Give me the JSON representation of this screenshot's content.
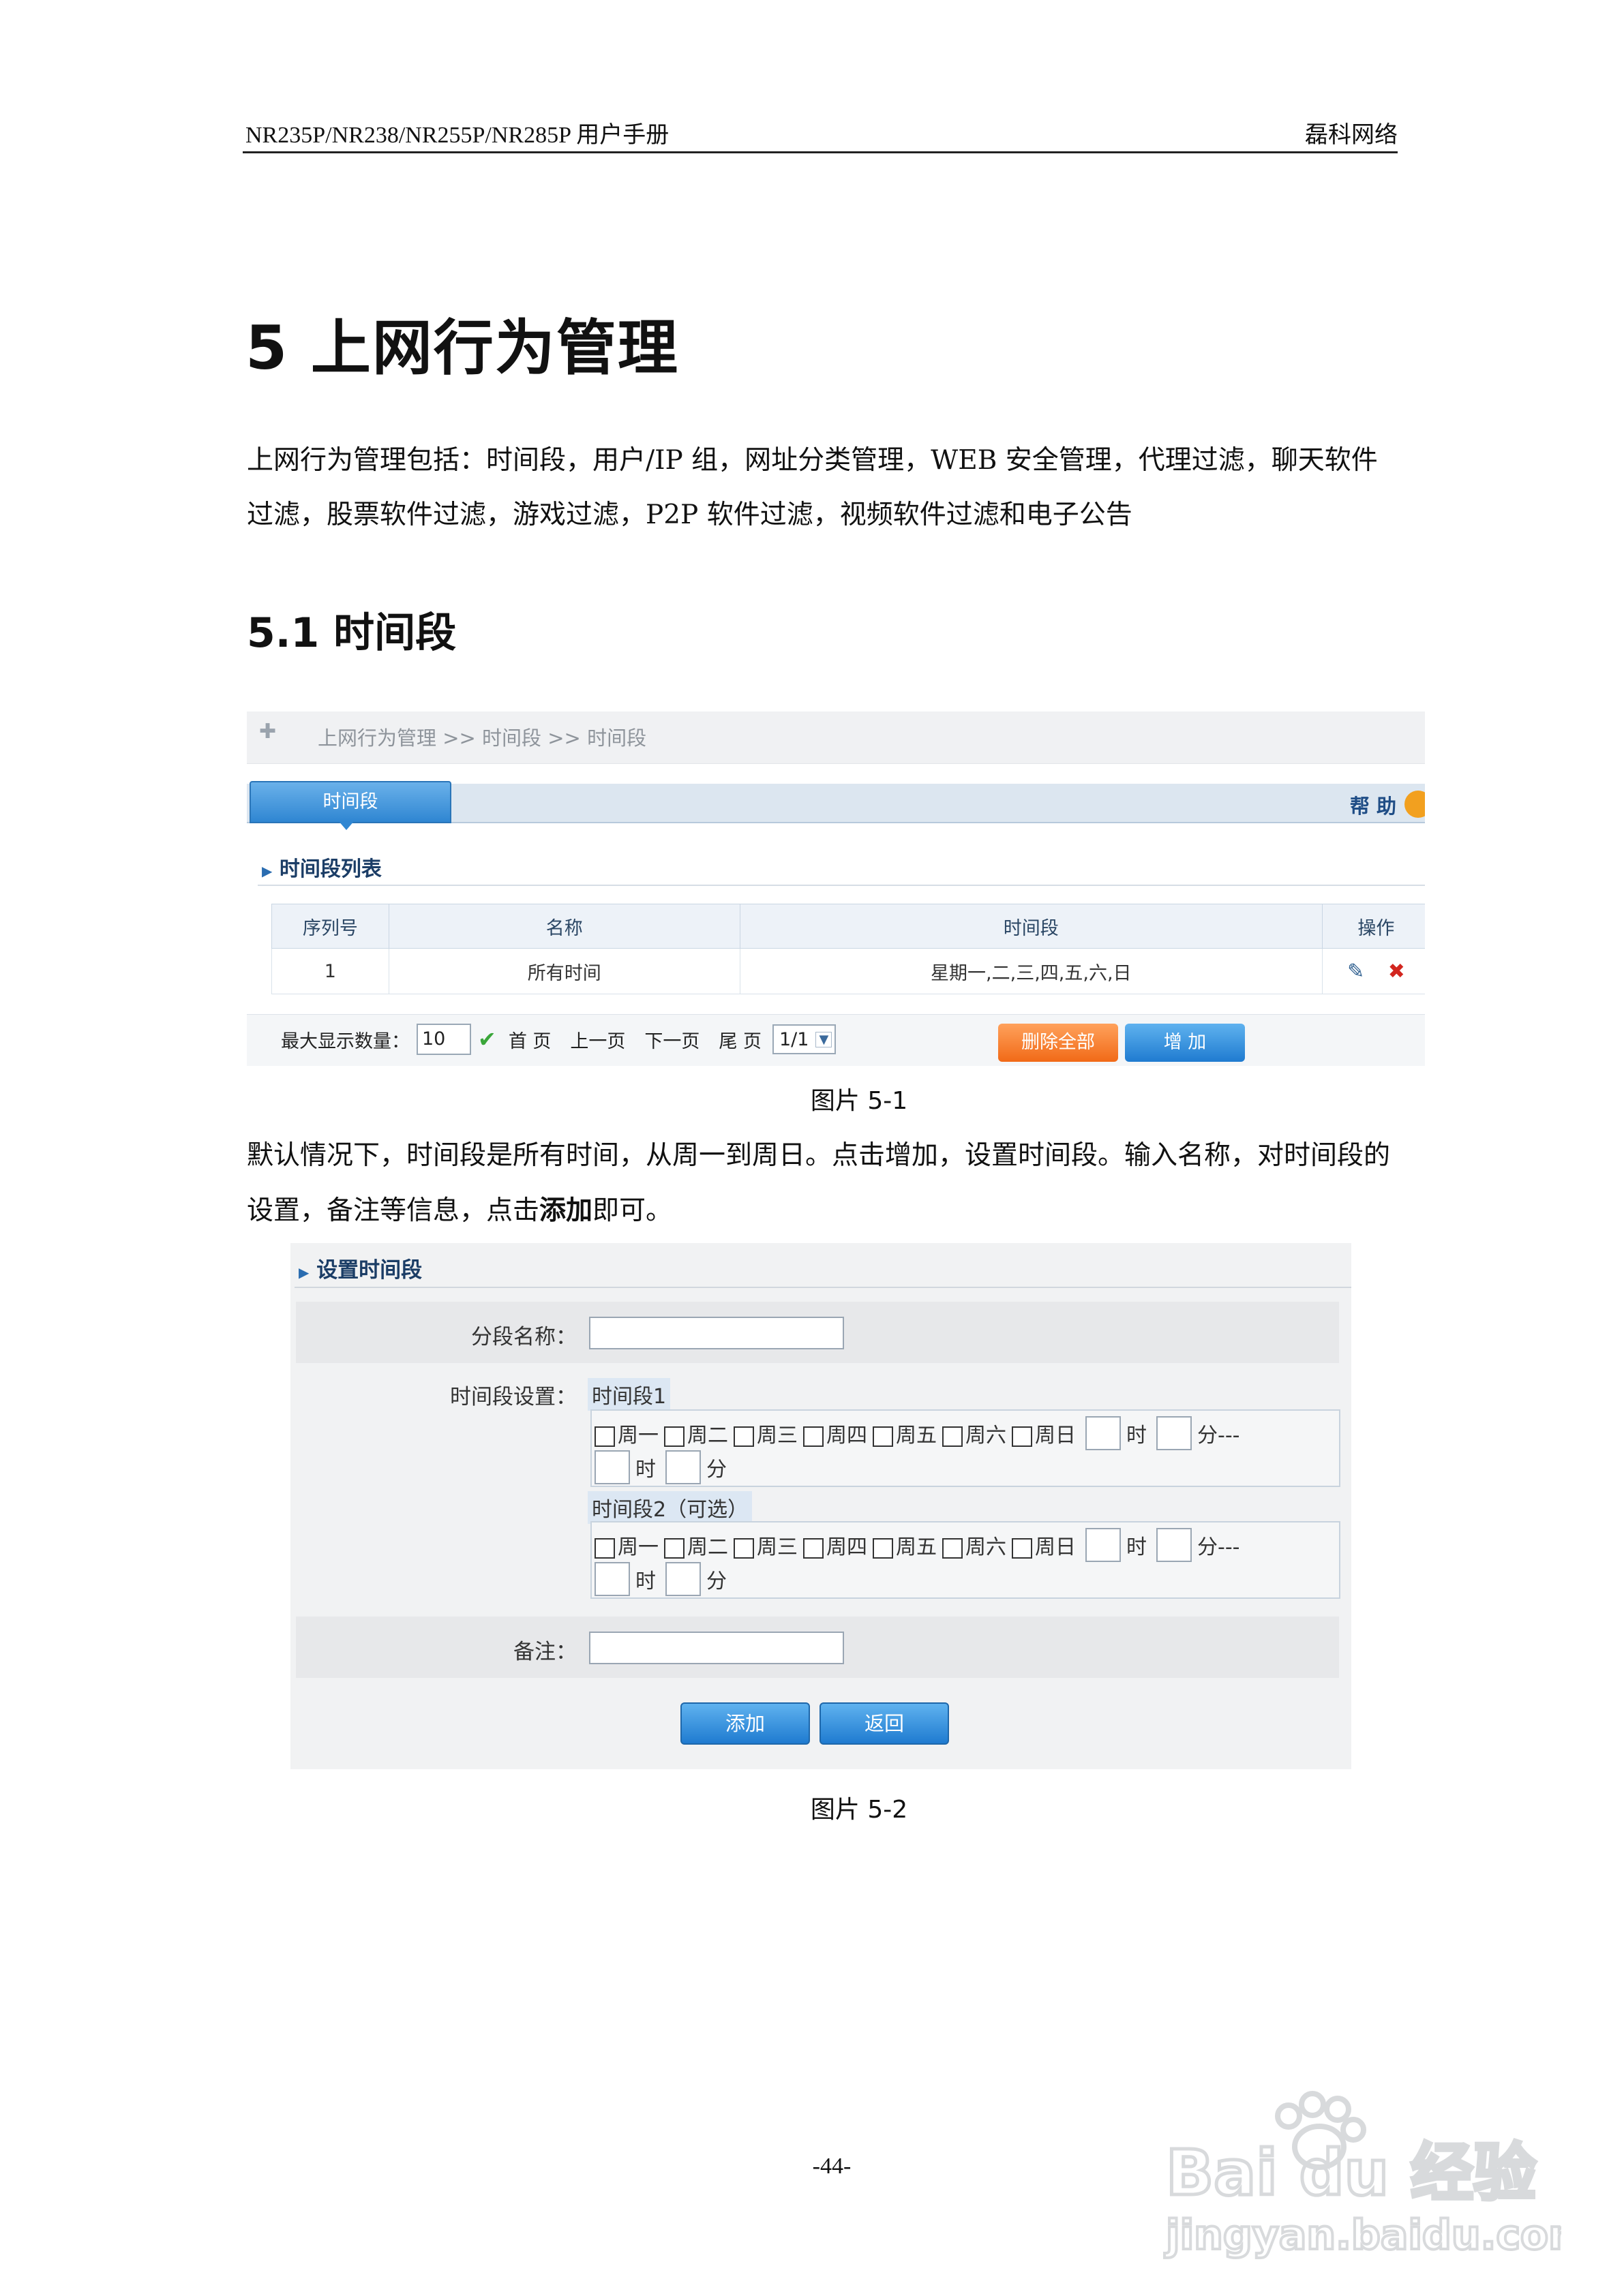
{
  "header": {
    "left": "NR235P/NR238/NR255P/NR285P 用户手册",
    "right": "磊科网络"
  },
  "chapter_title": "5 上网行为管理",
  "intro_text": "上网行为管理包括：时间段，用户/IP 组，网址分类管理，WEB 安全管理，代理过滤，聊天软件过滤，股票软件过滤，游戏过滤，P2P 软件过滤，视频软件过滤和电子公告",
  "section_title": "5.1 时间段",
  "figure1": {
    "breadcrumb": "上网行为管理 >> 时间段 >> 时间段",
    "tab": "时间段",
    "help": "帮 助",
    "list_title": "时间段列表",
    "columns": [
      "序列号",
      "名称",
      "时间段",
      "操作"
    ],
    "rows": [
      {
        "index": "1",
        "name": "所有时间",
        "period": "星期一,二,三,四,五,六,日"
      }
    ],
    "pager": {
      "max_label": "最大显示数量：",
      "max_value": "10",
      "first": "首 页",
      "prev": "上一页",
      "next": "下一页",
      "last": "尾 页",
      "page": "1/1"
    },
    "delete_all": "删除全部",
    "add": "增 加",
    "caption": "图片 5-1"
  },
  "body_text_1": "默认情况下，时间段是所有时间，从周一到周日。点击增加，设置时间段。输入名称，对时间段的设置，备注等信息，点击",
  "body_text_bold": "添加",
  "body_text_2": "即可。",
  "figure2": {
    "title": "设置时间段",
    "name_label": "分段名称：",
    "period_label": "时间段设置：",
    "period1_title": "时间段1",
    "period2_title": "时间段2（可选）",
    "days": [
      "周一",
      "周二",
      "周三",
      "周四",
      "周五",
      "周六",
      "周日"
    ],
    "hour": "时",
    "minute_to": "分---",
    "minute": "分",
    "note_label": "备注：",
    "add_button": "添加",
    "back_button": "返回",
    "caption": "图片 5-2"
  },
  "page_number": "-44-",
  "watermark": {
    "brand": "Bai du 经验",
    "url": "jingyan.baidu.com"
  }
}
